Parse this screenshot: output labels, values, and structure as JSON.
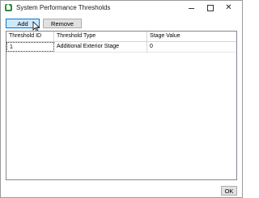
{
  "window": {
    "title": "System Performance Thresholds"
  },
  "toolbar": {
    "add_label": "Add",
    "remove_label": "Remove"
  },
  "table": {
    "columns": [
      "Threshold ID",
      "Threshold Type",
      "Stage Value"
    ],
    "rows": [
      [
        "1",
        "Additional Exterior Stage",
        "0"
      ]
    ]
  },
  "footer": {
    "ok_label": "OK"
  },
  "icons": {
    "app": "home-icon",
    "minimize": "minimize-icon",
    "maximize": "maximize-icon",
    "close": "close-icon",
    "cursor": "mouse-pointer-icon"
  },
  "colors": {
    "app_icon": "#2e8b3e",
    "add_button_bg": "#cde8fb",
    "add_button_border": "#0078d7"
  }
}
